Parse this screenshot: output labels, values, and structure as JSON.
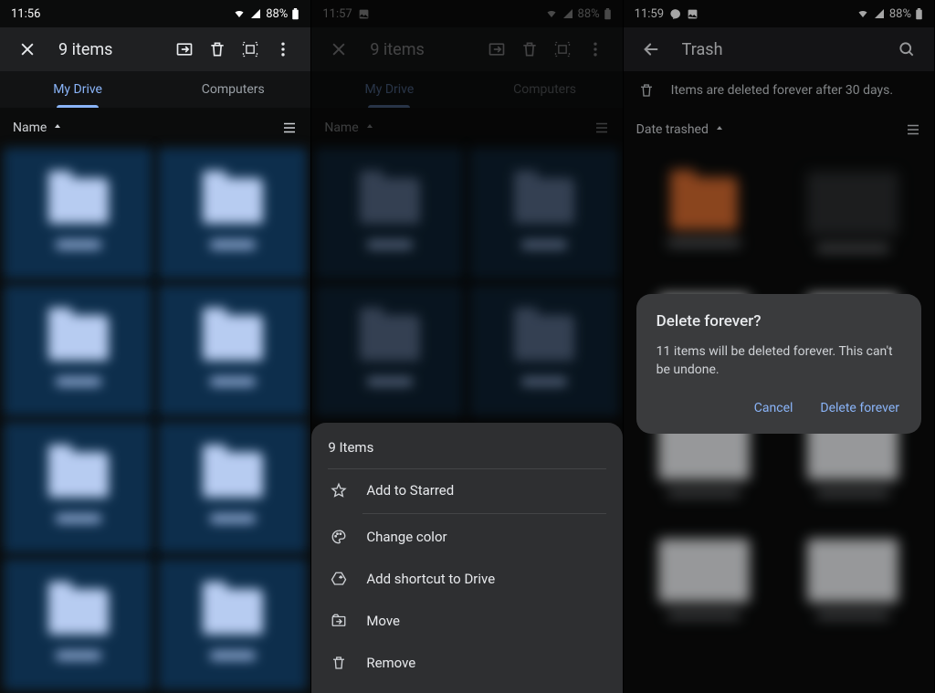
{
  "panel1": {
    "status": {
      "time": "11:56",
      "battery": "88%"
    },
    "app_bar": {
      "title": "9 items"
    },
    "tabs": {
      "my_drive": "My Drive",
      "computers": "Computers"
    },
    "sort": {
      "label": "Name"
    }
  },
  "panel2": {
    "status": {
      "time": "11:57",
      "battery": "88%"
    },
    "app_bar": {
      "title": "9 items"
    },
    "tabs": {
      "my_drive": "My Drive",
      "computers": "Computers"
    },
    "sort": {
      "label": "Name"
    },
    "sheet": {
      "title": "9 Items",
      "add_starred": "Add to Starred",
      "change_color": "Change color",
      "add_shortcut": "Add shortcut to Drive",
      "move": "Move",
      "remove": "Remove"
    }
  },
  "panel3": {
    "status": {
      "time": "11:59",
      "battery": "88%"
    },
    "app_bar": {
      "title": "Trash"
    },
    "info": "Items are deleted forever after 30 days.",
    "sort": {
      "label": "Date trashed"
    },
    "dialog": {
      "title": "Delete forever?",
      "body": "11 items will be deleted forever. This can't be undone.",
      "cancel": "Cancel",
      "confirm": "Delete forever"
    }
  },
  "icon_names": {
    "wifi": "wifi-icon",
    "signal": "signal-icon",
    "battery": "battery-icon"
  }
}
